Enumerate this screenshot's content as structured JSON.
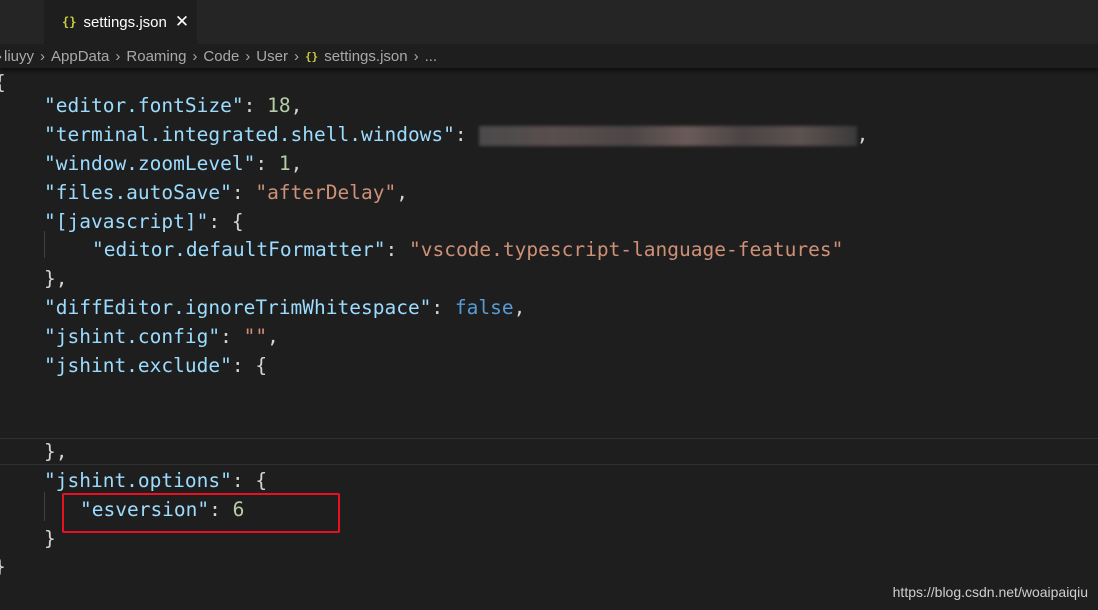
{
  "tab": {
    "icon": "{}",
    "label": "settings.json",
    "close": "✕"
  },
  "breadcrumb": {
    "items": [
      "liuyy",
      "AppData",
      "Roaming",
      "Code",
      "User",
      "settings.json",
      "..."
    ],
    "file_icon": "{}"
  },
  "code": {
    "open_brace": "{",
    "l1_key": "\"editor.fontSize\"",
    "l1_val": "18",
    "l2_key": "\"terminal.integrated.shell.windows\"",
    "l2_val_redacted": "",
    "l3_key": "\"window.zoomLevel\"",
    "l3_val": "1",
    "l4_key": "\"files.autoSave\"",
    "l4_val": "\"afterDelay\"",
    "l5_key": "\"[javascript]\"",
    "l6_key": "\"editor.defaultFormatter\"",
    "l6_val": "\"vscode.typescript-language-features\"",
    "l8_key": "\"diffEditor.ignoreTrimWhitespace\"",
    "l8_val": "false",
    "l9_key": "\"jshint.config\"",
    "l9_val": "\"\"",
    "l10_key": "\"jshint.exclude\"",
    "l14_key": "\"jshint.options\"",
    "l15_key": "\"esversion\"",
    "l15_val": "6",
    "close_brace": "}"
  },
  "watermark": "https://blog.csdn.net/woaipaiqiu",
  "colors": {
    "background": "#1e1e1e",
    "key": "#9cdcfe",
    "string": "#ce9178",
    "number": "#b5cea8",
    "boolean": "#569cd6",
    "highlight_box": "#e81123"
  }
}
